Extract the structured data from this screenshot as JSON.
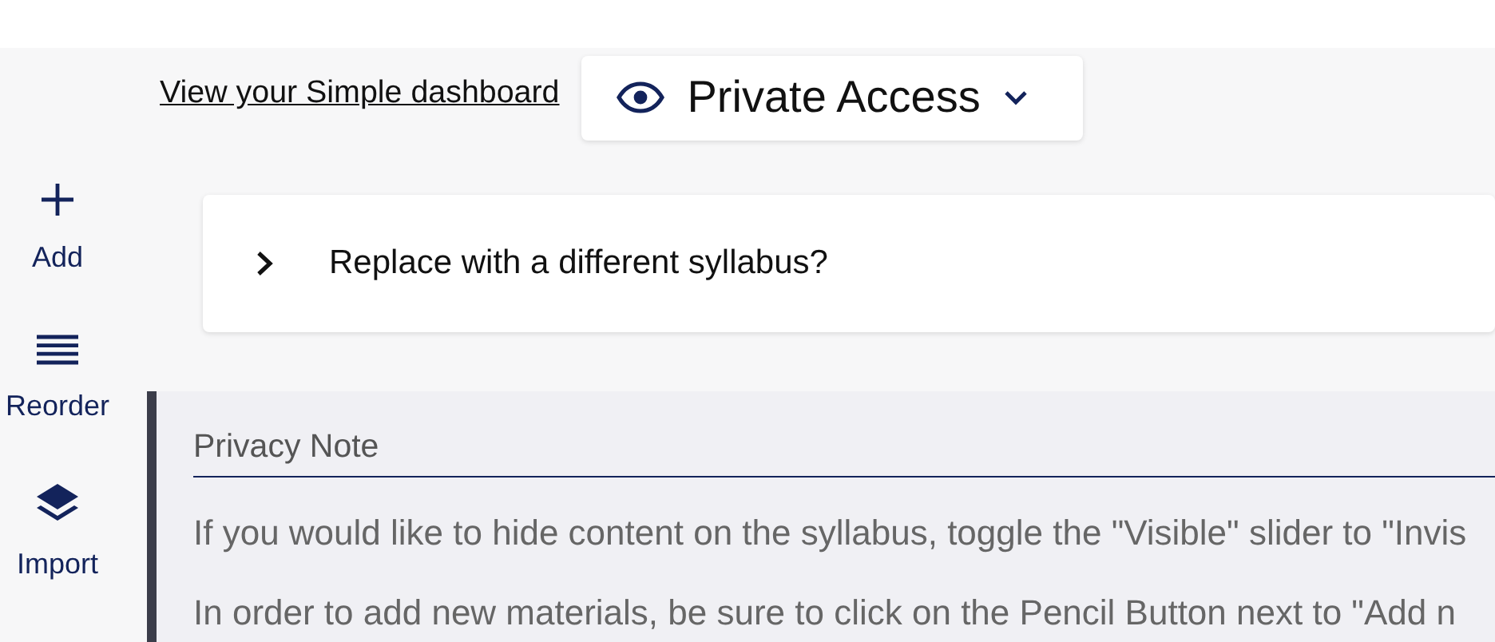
{
  "header": {
    "dashboard_link": "View your Simple dashboard",
    "access_menu": {
      "label": "Private Access"
    }
  },
  "sidebar": {
    "items": [
      {
        "kind": "add",
        "label": "Add"
      },
      {
        "kind": "reorder",
        "label": "Reorder"
      },
      {
        "kind": "import",
        "label": "Import"
      }
    ]
  },
  "syllabus_card": {
    "label": "Replace with a different syllabus?",
    "expanded": false
  },
  "privacy_note": {
    "title": "Privacy Note",
    "paragraphs": [
      "If you would like to hide content on the syllabus, toggle the \"Visible\" slider to \"Invis",
      "In order to add new materials, be sure to click on the Pencil Button next to \"Add n"
    ]
  }
}
